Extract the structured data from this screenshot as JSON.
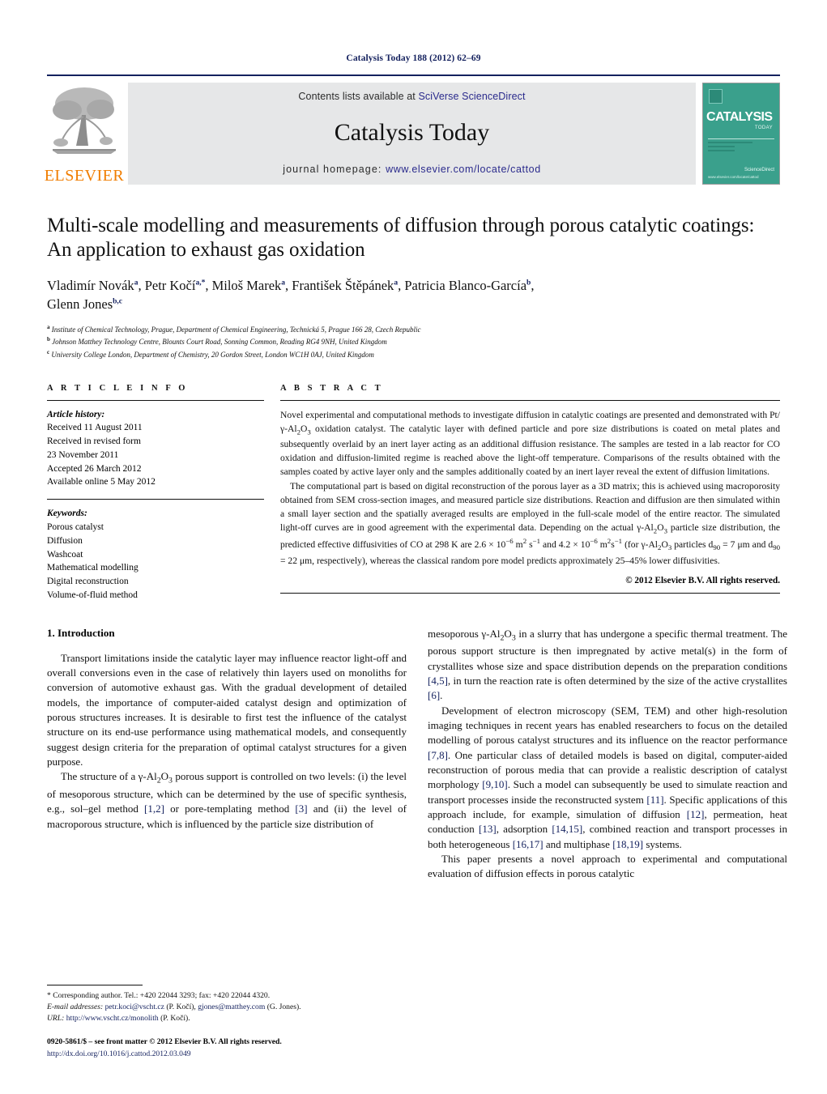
{
  "running_head": "Catalysis Today 188 (2012) 62–69",
  "masthead": {
    "publisher_wordmark": "ELSEVIER",
    "contents_prefix": "Contents lists available at ",
    "contents_link": "SciVerse ScienceDirect",
    "journal_name": "Catalysis Today",
    "homepage_prefix": "journal homepage: ",
    "homepage_url": "www.elsevier.com/locate/cattod",
    "cover": {
      "title": "CATALYSIS",
      "subtitle": "TODAY",
      "science_direct": "Available online at\nScienceDirect",
      "footer": "www.elsevier.com/locate/cattod"
    },
    "accent_orange": "#f07d00",
    "accent_navy": "#14215e",
    "banner_bg": "#e6e7e8",
    "cover_teal": "#3aa08c"
  },
  "article": {
    "title": "Multi-scale modelling and measurements of diffusion through porous catalytic coatings: An application to exhaust gas oxidation",
    "authors_line_1": "Vladimír Novák",
    "authors": [
      {
        "name": "Vladimír Novák",
        "marks": "a"
      },
      {
        "name": "Petr Kočí",
        "marks": "a,*"
      },
      {
        "name": "Miloš Marek",
        "marks": "a"
      },
      {
        "name": "František Štěpánek",
        "marks": "a"
      },
      {
        "name": "Patricia Blanco-García",
        "marks": "b"
      },
      {
        "name": "Glenn Jones",
        "marks": "b,c"
      }
    ],
    "affiliations": [
      {
        "mark": "a",
        "text": "Institute of Chemical Technology, Prague, Department of Chemical Engineering, Technická 5, Prague 166 28, Czech Republic"
      },
      {
        "mark": "b",
        "text": "Johnson Matthey Technology Centre, Blounts Court Road, Sonning Common, Reading RG4 9NH, United Kingdom"
      },
      {
        "mark": "c",
        "text": "University College London, Department of Chemistry, 20 Gordon Street, London WC1H 0AJ, United Kingdom"
      }
    ]
  },
  "article_info": {
    "label": "A R T I C L E  I N F O",
    "history_title": "Article history:",
    "history": [
      "Received 11 August 2011",
      "Received in revised form",
      "23 November 2011",
      "Accepted 26 March 2012",
      "Available online 5 May 2012"
    ],
    "keywords_title": "Keywords:",
    "keywords": [
      "Porous catalyst",
      "Diffusion",
      "Washcoat",
      "Mathematical modelling",
      "Digital reconstruction",
      "Volume-of-fluid method"
    ]
  },
  "abstract": {
    "label": "A B S T R A C T",
    "paragraph_1_pre": "Novel experimental and computational methods to investigate diffusion in catalytic coatings are presented and demonstrated with Pt/γ-Al",
    "paragraph_1_post": " oxidation catalyst. The catalytic layer with defined particle and pore size distributions is coated on metal plates and subsequently overlaid by an inert layer acting as an additional diffusion resistance. The samples are tested in a lab reactor for CO oxidation and diffusion-limited regime is reached above the light-off temperature. Comparisons of the results obtained with the samples coated by active layer only and the samples additionally coated by an inert layer reveal the extent of diffusion limitations.",
    "paragraph_2_a": "The computational part is based on digital reconstruction of the porous layer as a 3D matrix; this is achieved using macroporosity obtained from SEM cross-section images, and measured particle size distributions. Reaction and diffusion are then simulated within a small layer section and the spatially averaged results are employed in the full-scale model of the entire reactor. The simulated light-off curves are in good agreement with the experimental data. Depending on the actual γ-Al",
    "paragraph_2_b": " particle size distribution, the predicted effective diffusivities of CO at 298 K are 2.6 × 10",
    "paragraph_2_c": " m",
    "paragraph_2_d": " s",
    "paragraph_2_e": " and 4.2 × 10",
    "paragraph_2_f": " m",
    "paragraph_2_g": "s",
    "paragraph_2_h": " (for γ-Al",
    "paragraph_2_i": " particles d",
    "paragraph_2_j": " = 7 μm and d",
    "paragraph_2_k": " = 22 μm, respectively), whereas the classical random pore model predicts approximately 25–45% lower diffusivities.",
    "copyright": "© 2012 Elsevier B.V. All rights reserved."
  },
  "introduction": {
    "heading": "1.  Introduction",
    "left_p1": "Transport limitations inside the catalytic layer may influence reactor light-off and overall conversions even in the case of relatively thin layers used on monoliths for conversion of automotive exhaust gas. With the gradual development of detailed models, the importance of computer-aided catalyst design and optimization of porous structures increases. It is desirable to first test the influence of the catalyst structure on its end-use performance using mathematical models, and consequently suggest design criteria for the preparation of optimal catalyst structures for a given purpose.",
    "left_p2_a": "The structure of a γ-Al",
    "left_p2_b": " porous support is controlled on two levels: (i) the level of mesoporous structure, which can be determined by the use of specific synthesis, e.g., sol–gel method ",
    "left_p2_ref1": "[1,2]",
    "left_p2_c": " or pore-templating method ",
    "left_p2_ref2": "[3]",
    "left_p2_d": " and (ii) the level of macroporous structure, which is influenced by the particle size distribution of",
    "right_p1_a": "mesoporous γ-Al",
    "right_p1_b": " in a slurry that has undergone a specific thermal treatment. The porous support structure is then impregnated by active metal(s) in the form of crystallites whose size and space distribution depends on the preparation conditions ",
    "right_p1_ref1": "[4,5]",
    "right_p1_c": ", in turn the reaction rate is often determined by the size of the active crystallites ",
    "right_p1_ref2": "[6]",
    "right_p1_d": ".",
    "right_p2_a": "Development of electron microscopy (SEM, TEM) and other high-resolution imaging techniques in recent years has enabled researchers to focus on the detailed modelling of porous catalyst structures and its influence on the reactor performance ",
    "right_p2_ref1": "[7,8]",
    "right_p2_b": ". One particular class of detailed models is based on digital, computer-aided reconstruction of porous media that can provide a realistic description of catalyst morphology ",
    "right_p2_ref2": "[9,10]",
    "right_p2_c": ". Such a model can subsequently be used to simulate reaction and transport processes inside the reconstructed system ",
    "right_p2_ref3": "[11]",
    "right_p2_d": ". Specific applications of this approach include, for example, simulation of diffusion ",
    "right_p2_ref4": "[12]",
    "right_p2_e": ", permeation, heat conduction ",
    "right_p2_ref5": "[13]",
    "right_p2_f": ", adsorption ",
    "right_p2_ref6": "[14,15]",
    "right_p2_g": ", combined reaction and transport processes in both heterogeneous ",
    "right_p2_ref7": "[16,17]",
    "right_p2_h": " and multiphase ",
    "right_p2_ref8": "[18,19]",
    "right_p2_i": " systems.",
    "right_p3": "This paper presents a novel approach to experimental and computational evaluation of diffusion effects in porous catalytic"
  },
  "footnotes": {
    "corresponding": "* Corresponding author. Tel.: +420 22044 3293; fax: +420 22044 4320.",
    "email_label": "E-mail addresses:",
    "email_1": "petr.koci@vscht.cz",
    "email_1_owner": " (P. Kočí), ",
    "email_2": "gjones@matthey.com",
    "email_2_owner": " (G. Jones).",
    "url_label": "URL:",
    "url_value": " http://www.vscht.cz/monolith",
    "url_owner": " (P. Kočí).",
    "issn_line": "0920-5861/$ – see front matter © 2012 Elsevier B.V. All rights reserved.",
    "doi_line": "http://dx.doi.org/10.1016/j.cattod.2012.03.049"
  }
}
